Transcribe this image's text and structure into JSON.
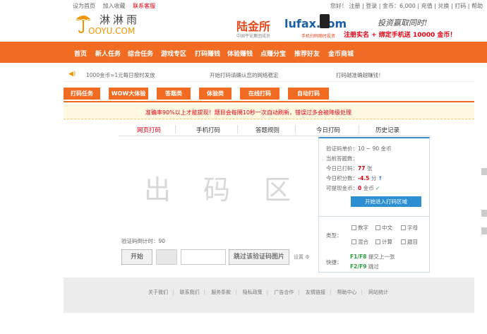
{
  "topbar": {
    "left": [
      "设为首页",
      "加入收藏",
      "联系客服"
    ],
    "right": "您好！ 注册 | 登录 | 金币：6,000 | 充值 | 兑换 | 打码 | 帮助"
  },
  "logo": {
    "cn": "淋淋雨",
    "en": "OOYU.COM"
  },
  "ad_lufax": {
    "brand_cn": "陆金所",
    "brand_en": "lufax.com",
    "sub1": "中国平安集团成员",
    "sub2": "手机扫码随时投资"
  },
  "ad_right": {
    "slogan": "投资赢取同时!",
    "cta": "注册实名 + 绑定手机送 10000 金币！"
  },
  "nav": [
    "首页",
    "新人任务",
    "综合任务",
    "游戏专区",
    "打码赚钱",
    "体验赚钱",
    "点赚分宝",
    "推荐好友",
    "金币商城"
  ],
  "notice": [
    "1000金币=1元每日按时发放",
    "开始打码请确认您的网络稳定",
    "打码越准确越赚钱！"
  ],
  "subtabs": [
    "打码任务",
    "WOW大体验",
    "答题类",
    "体验类",
    "在线打码",
    "自动打码"
  ],
  "warning": "准确率90%以上才能提现！题目会每隔10秒一次自动刷新，错误过多会被降级处理",
  "tabs": [
    {
      "label": "网页打码",
      "active": true
    },
    {
      "label": "手机打码",
      "active": false
    },
    {
      "label": "答题规则",
      "active": false
    },
    {
      "label": "今日打码",
      "active": false
    },
    {
      "label": "历史记录",
      "active": false
    }
  ],
  "code_area": {
    "chars": [
      "出",
      "码",
      "区"
    ]
  },
  "panel": {
    "rows": [
      {
        "label": "验证码单价：",
        "value": "10 ~ 90 金币"
      },
      {
        "label": "当前答题数：",
        "value": ""
      },
      {
        "label": "今日已打码：",
        "value": "77",
        "suffix": "张"
      },
      {
        "label": "今日积分数：",
        "value": "-4.5",
        "suffix": "分",
        "tag": "↑"
      },
      {
        "label": "可提现金币：",
        "value": "0",
        "suffix": "金币",
        "tag": "✓"
      }
    ],
    "join_button": "开始进入打码区域",
    "type_label": "类型：",
    "type_options": [
      "数字",
      "中文",
      "字母",
      "混合",
      "计算",
      "题目"
    ],
    "hotkey_label": "快捷：",
    "hotkeys": [
      {
        "key": "F1/F8",
        "desc": "提交上一张"
      },
      {
        "key": "F2/F9",
        "desc": "跳过"
      }
    ]
  },
  "controls": {
    "status_label": "验证码倒计时：",
    "status_value": "90",
    "start_button": "开始",
    "skip_button": "跳过该验证码图片",
    "setting_label": "设置"
  },
  "footer": {
    "links": [
      "关于我们",
      "联系我们",
      "服务条款",
      "隐私政策",
      "广告合作",
      "友情链接",
      "帮助中心",
      "网站统计"
    ]
  }
}
